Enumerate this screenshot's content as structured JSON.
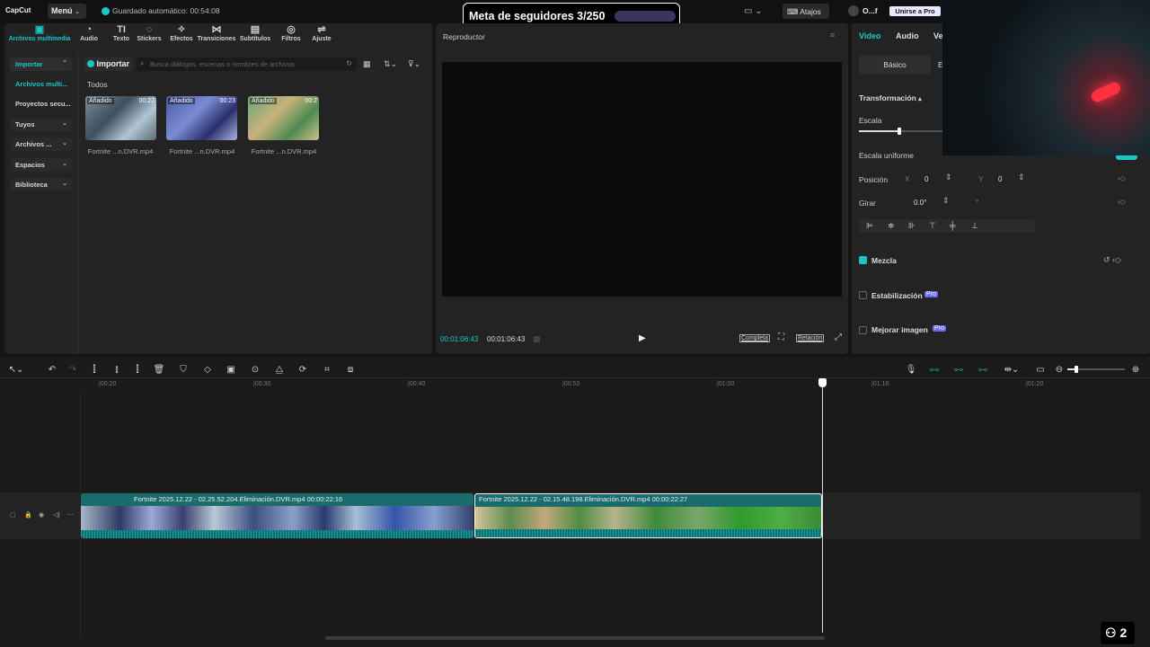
{
  "app": {
    "logo": "CapCut",
    "menu": "Menú",
    "autosave": "Guardado automático: 00:54:08",
    "goal": "Meta de seguidores 3/250",
    "shortcuts": "Atajos",
    "user": "O...f",
    "pro": "Unirse a Pro"
  },
  "tabs": [
    {
      "label": "Archivos multimedia",
      "icon": "media-icon",
      "glyph": "▣"
    },
    {
      "label": "Audio",
      "icon": "audio-icon",
      "glyph": "◔"
    },
    {
      "label": "Texto",
      "icon": "text-icon",
      "glyph": "TI"
    },
    {
      "label": "Stickers",
      "icon": "sticker-icon",
      "glyph": "◌"
    },
    {
      "label": "Efectos",
      "icon": "effects-icon",
      "glyph": "✧"
    },
    {
      "label": "Transiciones",
      "icon": "transition-icon",
      "glyph": "⋈"
    },
    {
      "label": "Subtítulos",
      "icon": "subtitle-icon",
      "glyph": "▤"
    },
    {
      "label": "Filtros",
      "icon": "filter-icon",
      "glyph": "◎"
    },
    {
      "label": "Ajuste",
      "icon": "adjust-icon",
      "glyph": "⇌"
    }
  ],
  "sidebar": [
    {
      "label": "Importar",
      "chev": "⌃"
    },
    {
      "label": "Archivos multi...",
      "chev": ""
    },
    {
      "label": "Proyectos secu...",
      "chev": ""
    },
    {
      "label": "Tuyos",
      "chev": "⌄"
    },
    {
      "label": "Archivos ...",
      "chev": "⌄"
    },
    {
      "label": "Espacios",
      "chev": "⌄"
    },
    {
      "label": "Biblioteca",
      "chev": "⌄"
    }
  ],
  "media": {
    "import": "Importar",
    "search_placeholder": "Busca diálogos, escenas o nombres de archivos",
    "section": "Todos",
    "items": [
      {
        "badge": "Añadido",
        "dur": "00:22",
        "name": "Fortnite ...n.DVR.mp4"
      },
      {
        "badge": "Añadido",
        "dur": "00:23",
        "name": "Fortnite ...n.DVR.mp4"
      },
      {
        "badge": "Añadido",
        "dur": "00:2",
        "name": "Fortnite ...n.DVR.mp4"
      }
    ]
  },
  "player": {
    "title": "Reproductor",
    "current": "00:01:06:43",
    "total": "00:01:06:43",
    "complete": "Completa",
    "ratio": "Relación"
  },
  "props": {
    "tab_video": "Video",
    "tab_audio": "Audio",
    "tab_more": "Ve",
    "sub_basic": "Básico",
    "sub_more": "E",
    "transform": "Transformación",
    "scale": "Escala",
    "uniform": "Escala uniforme",
    "position": "Posición",
    "x_lbl": "X",
    "x_val": "0",
    "y_lbl": "Y",
    "y_val": "0",
    "rotate": "Girar",
    "rotate_val": "0.0°",
    "blend": "Mezcla",
    "stabilize": "Estabilización",
    "enhance": "Mejorar imagen",
    "pro_tag": "Pro",
    "scale_fraction": 0.45
  },
  "timeline": {
    "ticks": [
      "|00:20",
      "|00:30",
      "|00:40",
      "|00:50",
      "|01:00",
      "|01:10",
      "|01:20"
    ],
    "clip1": "Fortnite 2025.12.22 - 02.25.52.204.Eliminación.DVR.mp4   00:00:22:16",
    "clip2": "Fortnite 2025.12.22 - 02.15.48.198.Eliminación.DVR.mp4   00:00:22:27"
  },
  "viewers": "2",
  "colors": {
    "accent": "#1bc6c6",
    "clip": "#1a7a7a",
    "bg": "#151515",
    "panel": "#232323"
  }
}
